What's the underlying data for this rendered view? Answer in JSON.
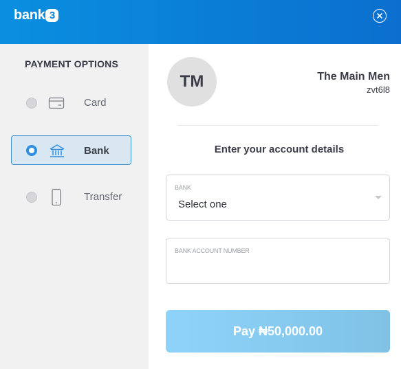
{
  "header": {
    "logo_text": "bank",
    "logo_badge": "3",
    "close_icon": "close-circle-icon"
  },
  "sidebar": {
    "title": "PAYMENT OPTIONS",
    "options": [
      {
        "label": "Card",
        "icon": "card-icon",
        "selected": false
      },
      {
        "label": "Bank",
        "icon": "bank-building-icon",
        "selected": true
      },
      {
        "label": "Transfer",
        "icon": "phone-icon",
        "selected": false
      }
    ]
  },
  "merchant": {
    "initials": "TM",
    "name": "The Main Men",
    "code": "zvt6l8"
  },
  "form": {
    "title": "Enter your account details",
    "bank": {
      "label": "BANK",
      "value": "Select one"
    },
    "account_number": {
      "label": "BANK ACCOUNT NUMBER",
      "value": ""
    }
  },
  "pay_button": {
    "label": "Pay ₦50,000.00"
  },
  "colors": {
    "header": "#0b7fd9",
    "accent": "#2f8fe0",
    "pay_button": "#87cbf0"
  }
}
